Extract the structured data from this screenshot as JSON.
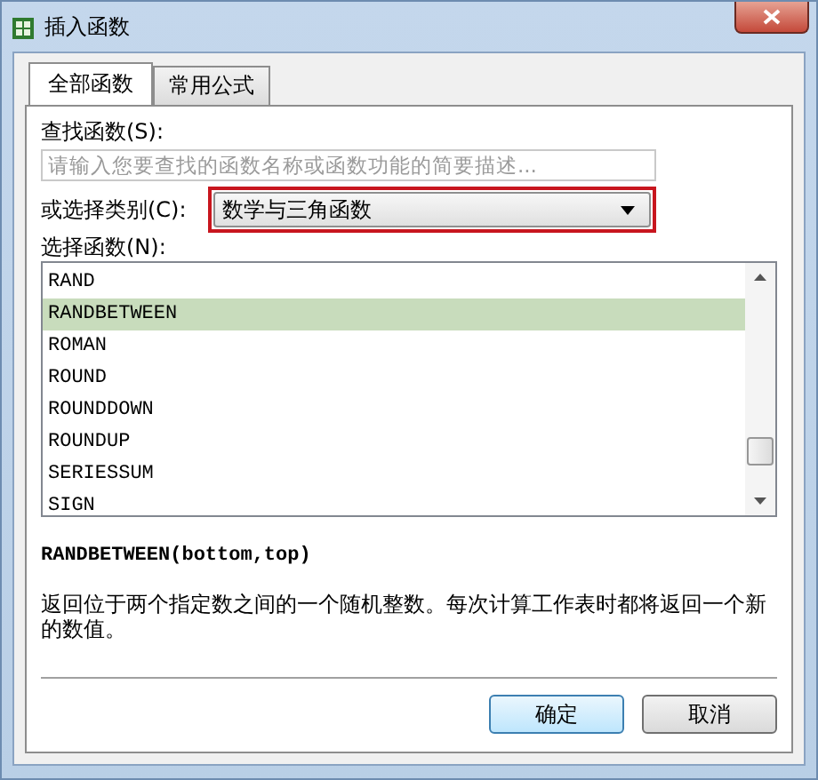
{
  "window": {
    "title": "插入函数"
  },
  "tabs": [
    {
      "label": "全部函数",
      "selected": true
    },
    {
      "label": "常用公式",
      "selected": false
    }
  ],
  "search": {
    "label": "查找函数(S):",
    "placeholder": "请输入您要查找的函数名称或函数功能的简要描述..."
  },
  "category": {
    "label": "或选择类别(C):",
    "value": "数学与三角函数"
  },
  "function_list": {
    "label": "选择函数(N):",
    "items": [
      {
        "name": "RAND",
        "selected": false
      },
      {
        "name": "RANDBETWEEN",
        "selected": true
      },
      {
        "name": "ROMAN",
        "selected": false
      },
      {
        "name": "ROUND",
        "selected": false
      },
      {
        "name": "ROUNDDOWN",
        "selected": false
      },
      {
        "name": "ROUNDUP",
        "selected": false
      },
      {
        "name": "SERIESSUM",
        "selected": false
      },
      {
        "name": "SIGN",
        "selected": false
      }
    ]
  },
  "signature": "RANDBETWEEN(bottom,top)",
  "description": "返回位于两个指定数之间的一个随机整数。每次计算工作表时都将返回一个新的数值。",
  "buttons": [
    "确定",
    "取消"
  ]
}
